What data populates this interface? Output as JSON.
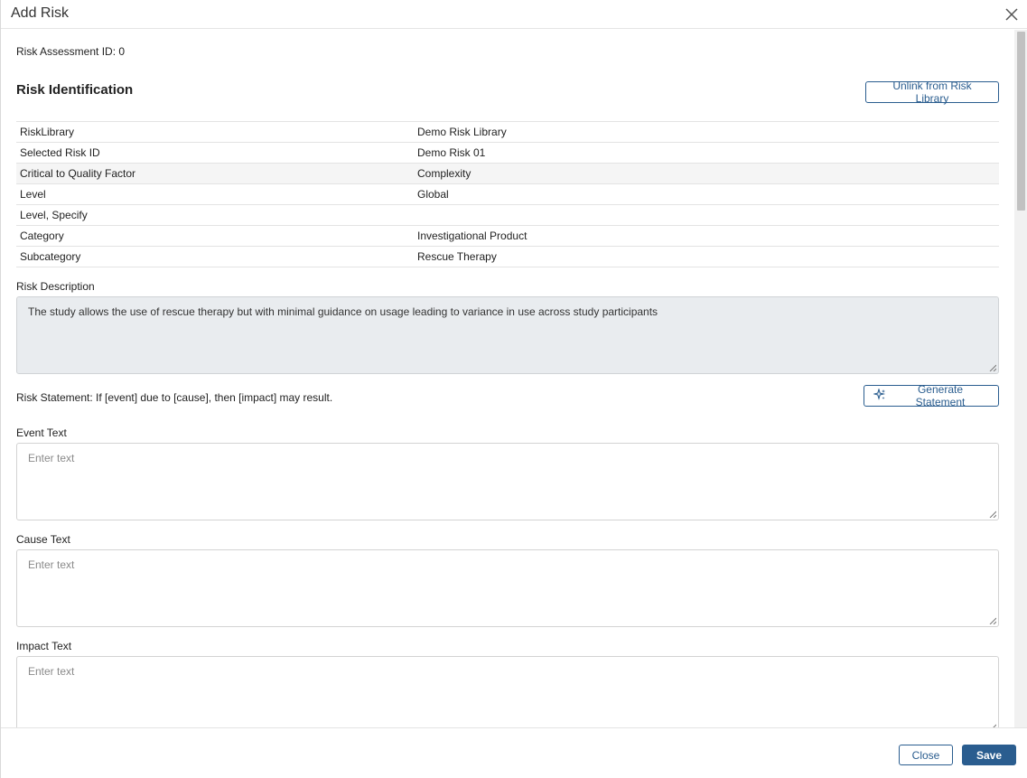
{
  "dialog": {
    "title": "Add Risk",
    "close_icon": "close-icon"
  },
  "assessment": {
    "id_text": "Risk Assessment ID: 0"
  },
  "identification": {
    "title": "Risk Identification",
    "unlink_label": "Unlink from Risk Library",
    "rows": [
      {
        "key": "RiskLibrary",
        "value": "Demo Risk Library"
      },
      {
        "key": "Selected Risk ID",
        "value": "Demo Risk 01"
      },
      {
        "key": "Critical to Quality Factor",
        "value": "Complexity"
      },
      {
        "key": "Level",
        "value": "Global"
      },
      {
        "key": "Level, Specify",
        "value": ""
      },
      {
        "key": "Category",
        "value": "Investigational Product"
      },
      {
        "key": "Subcategory",
        "value": "Rescue Therapy"
      }
    ]
  },
  "description": {
    "label": "Risk Description",
    "value": "The study allows the use of rescue therapy but with minimal guidance on usage leading to variance in use across study participants"
  },
  "statement": {
    "text": "Risk Statement: If [event] due to [cause], then [impact] may result.",
    "generate_label": "Generate Statement",
    "generate_icon": "sparkle-icon"
  },
  "event": {
    "label": "Event Text",
    "placeholder": "Enter text"
  },
  "cause": {
    "label": "Cause Text",
    "placeholder": "Enter text"
  },
  "impact": {
    "label": "Impact Text",
    "placeholder": "Enter text"
  },
  "footer": {
    "close_label": "Close",
    "save_label": "Save"
  },
  "colors": {
    "accent": "#2a5d8f",
    "readonly_bg": "#e9ecef"
  }
}
